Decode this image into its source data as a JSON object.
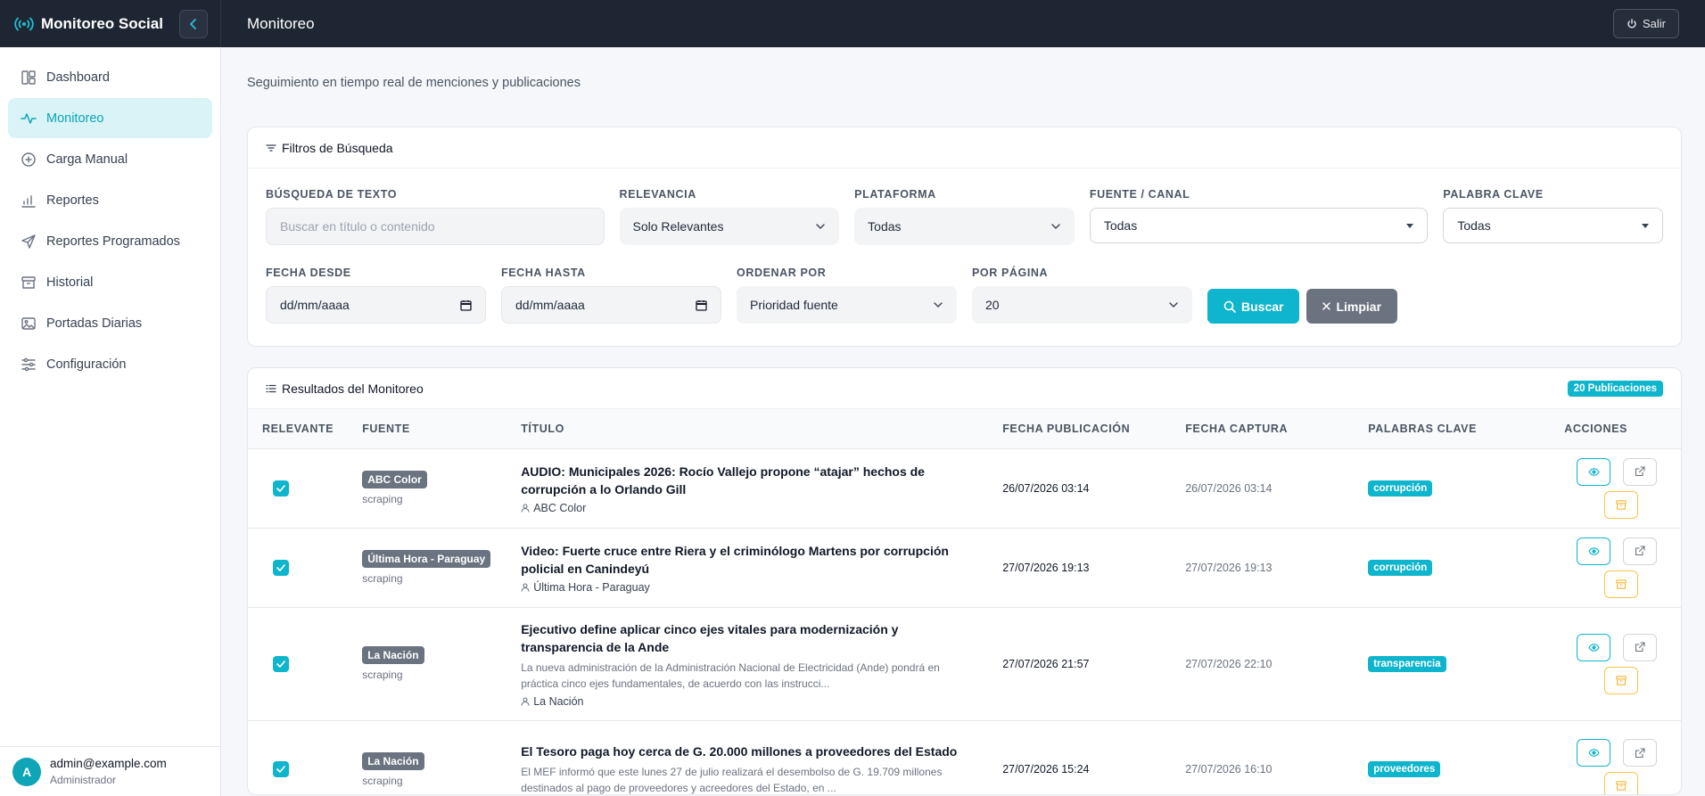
{
  "brand": {
    "name": "Monitoreo Social",
    "icon": "broadcast-icon",
    "collapse_icon": "chevron-left-icon"
  },
  "topbar": {
    "title": "Monitoreo",
    "logout_label": "Salir",
    "logout_icon": "power-icon"
  },
  "sidebar": {
    "items": [
      {
        "label": "Dashboard",
        "icon": "dashboard-icon"
      },
      {
        "label": "Monitoreo",
        "icon": "activity-icon",
        "active": true
      },
      {
        "label": "Carga Manual",
        "icon": "plus-circle-icon"
      },
      {
        "label": "Reportes",
        "icon": "bar-chart-icon"
      },
      {
        "label": "Reportes Programados",
        "icon": "send-icon"
      },
      {
        "label": "Historial",
        "icon": "archive-icon"
      },
      {
        "label": "Portadas Diarias",
        "icon": "image-icon"
      },
      {
        "label": "Configuración",
        "icon": "sliders-icon"
      }
    ],
    "user": {
      "initial": "A",
      "email": "admin@example.com",
      "role": "Administrador"
    }
  },
  "page": {
    "subtitle": "Seguimiento en tiempo real de menciones y publicaciones"
  },
  "filters": {
    "title": "Filtros de Búsqueda",
    "text_label": "BÚSQUEDA DE TEXTO",
    "text_placeholder": "Buscar en título o contenido",
    "relevance_label": "RELEVANCIA",
    "relevance_value": "Solo Relevantes",
    "platform_label": "PLATAFORMA",
    "platform_value": "Todas",
    "source_label": "FUENTE / CANAL",
    "source_value": "Todas",
    "keyword_label": "PALABRA CLAVE",
    "keyword_value": "Todas",
    "date_from_label": "FECHA DESDE",
    "date_from_value": "dd/mm/aaaa",
    "date_to_label": "FECHA HASTA",
    "date_to_value": "dd/mm/aaaa",
    "order_label": "ORDENAR POR",
    "order_value": "Prioridad fuente",
    "per_page_label": "POR PÁGINA",
    "per_page_value": "20",
    "search_label": "Buscar",
    "clear_label": "Limpiar"
  },
  "results": {
    "title": "Resultados del Monitoreo",
    "count_label": "20 Publicaciones",
    "columns": [
      "RELEVANTE",
      "FUENTE",
      "TÍTULO",
      "FECHA PUBLICACIÓN",
      "FECHA CAPTURA",
      "PALABRAS CLAVE",
      "ACCIONES"
    ],
    "rows": [
      {
        "relevant": true,
        "source": "ABC Color",
        "method": "scraping",
        "title": "AUDIO: Municipales 2026: Rocío Vallejo propone “atajar” hechos de corrupción a lo Orlando Gill",
        "summary": "",
        "author": "ABC Color",
        "published": "26/07/2026 03:14",
        "captured": "26/07/2026 03:14",
        "keyword": "corrupción"
      },
      {
        "relevant": true,
        "source": "Última Hora - Paraguay",
        "method": "scraping",
        "title": "Video: Fuerte cruce entre Riera y el criminólogo Martens por corrupción policial en Canindeyú",
        "summary": "",
        "author": "Última Hora - Paraguay",
        "published": "27/07/2026 19:13",
        "captured": "27/07/2026 19:13",
        "keyword": "corrupción"
      },
      {
        "relevant": true,
        "source": "La Nación",
        "method": "scraping",
        "title": "Ejecutivo define aplicar cinco ejes vitales para modernización y transparencia de la Ande",
        "summary": "La nueva administración de la Administración Nacional de Electricidad (Ande) pondrá en práctica cinco ejes fundamentales, de acuerdo con las instrucci...",
        "author": "La Nación",
        "published": "27/07/2026 21:57",
        "captured": "27/07/2026 22:10",
        "keyword": "transparencia"
      },
      {
        "relevant": true,
        "source": "La Nación",
        "method": "scraping",
        "title": "El Tesoro paga hoy cerca de G. 20.000 millones a proveedores del Estado",
        "summary": "El MEF informó que este lunes 27 de julio realizará el desembolso de G. 19.709 millones destinados al pago de proveedores y acreedores del Estado, en ...",
        "author": "",
        "published": "27/07/2026 15:24",
        "captured": "27/07/2026 16:10",
        "keyword": "proveedores"
      }
    ]
  },
  "colors": {
    "accent": "#0fb5cc",
    "dark": "#1e2533",
    "archive": "#f5c44e",
    "muted_badge": "#6b7280"
  }
}
